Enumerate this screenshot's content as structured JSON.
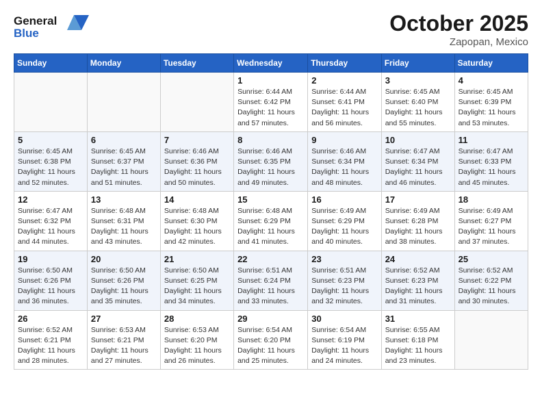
{
  "header": {
    "logo_line1": "General",
    "logo_line2": "Blue",
    "month": "October 2025",
    "location": "Zapopan, Mexico"
  },
  "weekdays": [
    "Sunday",
    "Monday",
    "Tuesday",
    "Wednesday",
    "Thursday",
    "Friday",
    "Saturday"
  ],
  "weeks": [
    [
      {
        "day": "",
        "sunrise": "",
        "sunset": "",
        "daylight": ""
      },
      {
        "day": "",
        "sunrise": "",
        "sunset": "",
        "daylight": ""
      },
      {
        "day": "",
        "sunrise": "",
        "sunset": "",
        "daylight": ""
      },
      {
        "day": "1",
        "sunrise": "Sunrise: 6:44 AM",
        "sunset": "Sunset: 6:42 PM",
        "daylight": "Daylight: 11 hours and 57 minutes."
      },
      {
        "day": "2",
        "sunrise": "Sunrise: 6:44 AM",
        "sunset": "Sunset: 6:41 PM",
        "daylight": "Daylight: 11 hours and 56 minutes."
      },
      {
        "day": "3",
        "sunrise": "Sunrise: 6:45 AM",
        "sunset": "Sunset: 6:40 PM",
        "daylight": "Daylight: 11 hours and 55 minutes."
      },
      {
        "day": "4",
        "sunrise": "Sunrise: 6:45 AM",
        "sunset": "Sunset: 6:39 PM",
        "daylight": "Daylight: 11 hours and 53 minutes."
      }
    ],
    [
      {
        "day": "5",
        "sunrise": "Sunrise: 6:45 AM",
        "sunset": "Sunset: 6:38 PM",
        "daylight": "Daylight: 11 hours and 52 minutes."
      },
      {
        "day": "6",
        "sunrise": "Sunrise: 6:45 AM",
        "sunset": "Sunset: 6:37 PM",
        "daylight": "Daylight: 11 hours and 51 minutes."
      },
      {
        "day": "7",
        "sunrise": "Sunrise: 6:46 AM",
        "sunset": "Sunset: 6:36 PM",
        "daylight": "Daylight: 11 hours and 50 minutes."
      },
      {
        "day": "8",
        "sunrise": "Sunrise: 6:46 AM",
        "sunset": "Sunset: 6:35 PM",
        "daylight": "Daylight: 11 hours and 49 minutes."
      },
      {
        "day": "9",
        "sunrise": "Sunrise: 6:46 AM",
        "sunset": "Sunset: 6:34 PM",
        "daylight": "Daylight: 11 hours and 48 minutes."
      },
      {
        "day": "10",
        "sunrise": "Sunrise: 6:47 AM",
        "sunset": "Sunset: 6:34 PM",
        "daylight": "Daylight: 11 hours and 46 minutes."
      },
      {
        "day": "11",
        "sunrise": "Sunrise: 6:47 AM",
        "sunset": "Sunset: 6:33 PM",
        "daylight": "Daylight: 11 hours and 45 minutes."
      }
    ],
    [
      {
        "day": "12",
        "sunrise": "Sunrise: 6:47 AM",
        "sunset": "Sunset: 6:32 PM",
        "daylight": "Daylight: 11 hours and 44 minutes."
      },
      {
        "day": "13",
        "sunrise": "Sunrise: 6:48 AM",
        "sunset": "Sunset: 6:31 PM",
        "daylight": "Daylight: 11 hours and 43 minutes."
      },
      {
        "day": "14",
        "sunrise": "Sunrise: 6:48 AM",
        "sunset": "Sunset: 6:30 PM",
        "daylight": "Daylight: 11 hours and 42 minutes."
      },
      {
        "day": "15",
        "sunrise": "Sunrise: 6:48 AM",
        "sunset": "Sunset: 6:29 PM",
        "daylight": "Daylight: 11 hours and 41 minutes."
      },
      {
        "day": "16",
        "sunrise": "Sunrise: 6:49 AM",
        "sunset": "Sunset: 6:29 PM",
        "daylight": "Daylight: 11 hours and 40 minutes."
      },
      {
        "day": "17",
        "sunrise": "Sunrise: 6:49 AM",
        "sunset": "Sunset: 6:28 PM",
        "daylight": "Daylight: 11 hours and 38 minutes."
      },
      {
        "day": "18",
        "sunrise": "Sunrise: 6:49 AM",
        "sunset": "Sunset: 6:27 PM",
        "daylight": "Daylight: 11 hours and 37 minutes."
      }
    ],
    [
      {
        "day": "19",
        "sunrise": "Sunrise: 6:50 AM",
        "sunset": "Sunset: 6:26 PM",
        "daylight": "Daylight: 11 hours and 36 minutes."
      },
      {
        "day": "20",
        "sunrise": "Sunrise: 6:50 AM",
        "sunset": "Sunset: 6:26 PM",
        "daylight": "Daylight: 11 hours and 35 minutes."
      },
      {
        "day": "21",
        "sunrise": "Sunrise: 6:50 AM",
        "sunset": "Sunset: 6:25 PM",
        "daylight": "Daylight: 11 hours and 34 minutes."
      },
      {
        "day": "22",
        "sunrise": "Sunrise: 6:51 AM",
        "sunset": "Sunset: 6:24 PM",
        "daylight": "Daylight: 11 hours and 33 minutes."
      },
      {
        "day": "23",
        "sunrise": "Sunrise: 6:51 AM",
        "sunset": "Sunset: 6:23 PM",
        "daylight": "Daylight: 11 hours and 32 minutes."
      },
      {
        "day": "24",
        "sunrise": "Sunrise: 6:52 AM",
        "sunset": "Sunset: 6:23 PM",
        "daylight": "Daylight: 11 hours and 31 minutes."
      },
      {
        "day": "25",
        "sunrise": "Sunrise: 6:52 AM",
        "sunset": "Sunset: 6:22 PM",
        "daylight": "Daylight: 11 hours and 30 minutes."
      }
    ],
    [
      {
        "day": "26",
        "sunrise": "Sunrise: 6:52 AM",
        "sunset": "Sunset: 6:21 PM",
        "daylight": "Daylight: 11 hours and 28 minutes."
      },
      {
        "day": "27",
        "sunrise": "Sunrise: 6:53 AM",
        "sunset": "Sunset: 6:21 PM",
        "daylight": "Daylight: 11 hours and 27 minutes."
      },
      {
        "day": "28",
        "sunrise": "Sunrise: 6:53 AM",
        "sunset": "Sunset: 6:20 PM",
        "daylight": "Daylight: 11 hours and 26 minutes."
      },
      {
        "day": "29",
        "sunrise": "Sunrise: 6:54 AM",
        "sunset": "Sunset: 6:20 PM",
        "daylight": "Daylight: 11 hours and 25 minutes."
      },
      {
        "day": "30",
        "sunrise": "Sunrise: 6:54 AM",
        "sunset": "Sunset: 6:19 PM",
        "daylight": "Daylight: 11 hours and 24 minutes."
      },
      {
        "day": "31",
        "sunrise": "Sunrise: 6:55 AM",
        "sunset": "Sunset: 6:18 PM",
        "daylight": "Daylight: 11 hours and 23 minutes."
      },
      {
        "day": "",
        "sunrise": "",
        "sunset": "",
        "daylight": ""
      }
    ]
  ]
}
